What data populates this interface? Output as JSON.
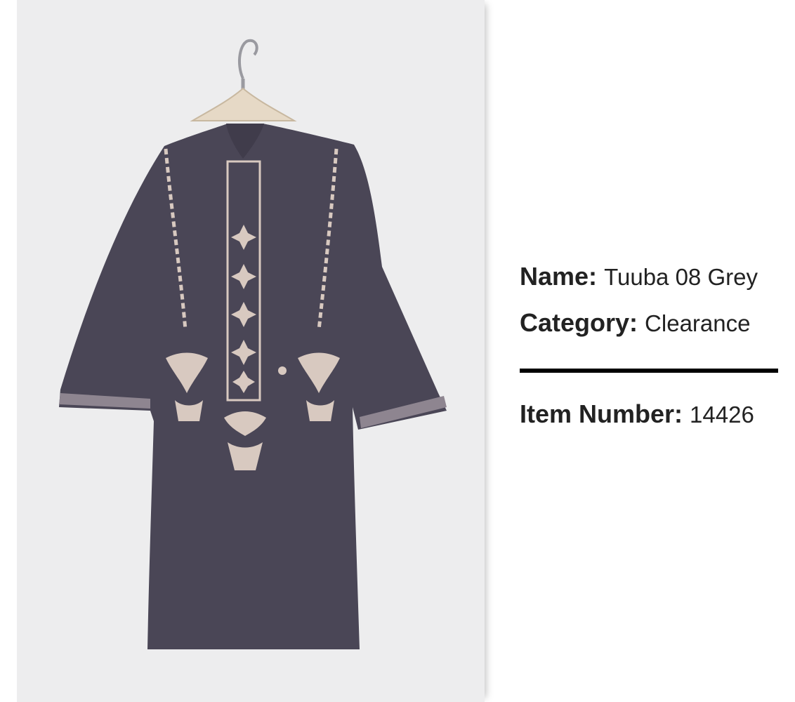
{
  "product": {
    "name_label": "Name:",
    "name_value": "Tuuba 08 Grey",
    "category_label": "Category:",
    "category_value": "Clearance",
    "item_label": "Item Number:",
    "item_value": "14426"
  },
  "colors": {
    "background": "#ffffff",
    "photo_background": "#ededee",
    "garment": "#4a4656",
    "embroidery": "#d8c9c0",
    "text": "#222222",
    "divider": "#000000"
  }
}
